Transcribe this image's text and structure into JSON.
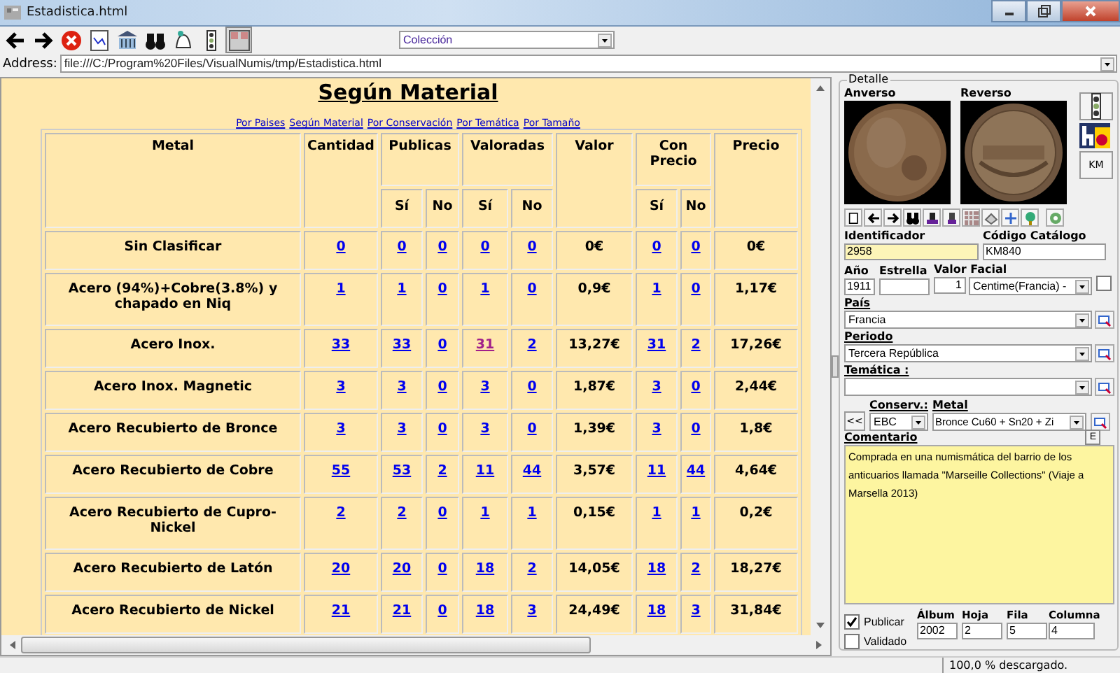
{
  "window": {
    "title": "Estadistica.html"
  },
  "toolbar": {
    "collection": "Colección"
  },
  "address": {
    "label": "Address:",
    "value": "file:///C:/Program%20Files/VisualNumis/tmp/Estadistica.html"
  },
  "page": {
    "heading": "Según Material",
    "nav_links": [
      {
        "label": "Por Paises"
      },
      {
        "label": "Según Material"
      },
      {
        "label": "Por Conservación"
      },
      {
        "label": "Por Temática"
      },
      {
        "label": "Por Tamaño"
      }
    ],
    "table": {
      "headers": {
        "metal": "Metal",
        "cantidad": "Cantidad",
        "publicas": "Publicas",
        "valoradas": "Valoradas",
        "valor": "Valor",
        "con_precio": "Con Precio",
        "precio": "Precio",
        "publicas_si": "Sí",
        "publicas_no": "No",
        "valoradas_si": "Sí",
        "valoradas_no": "No",
        "con_precio_si": "Sí",
        "con_precio_no": "No"
      },
      "rows": [
        {
          "metal": "Sin Clasificar",
          "cantidad": "0",
          "publicas_si": "0",
          "publicas_no": "0",
          "valoradas_si": "0",
          "valoradas_no": "0",
          "valor": "0€",
          "con_precio_si": "0",
          "con_precio_no": "0",
          "precio": "0€"
        },
        {
          "metal": "Acero (94%)+Cobre(3.8%) y chapado en Niq",
          "cantidad": "1",
          "publicas_si": "1",
          "publicas_no": "0",
          "valoradas_si": "1",
          "valoradas_no": "0",
          "valor": "0,9€",
          "con_precio_si": "1",
          "con_precio_no": "0",
          "precio": "1,17€"
        },
        {
          "metal": "Acero Inox.",
          "cantidad": "33",
          "publicas_si": "33",
          "publicas_no": "0",
          "valoradas_si": "31",
          "valoradas_no": "2",
          "valor": "13,27€",
          "con_precio_si": "31",
          "con_precio_no": "2",
          "precio": "17,26€",
          "valoradas_si_visited": true
        },
        {
          "metal": "Acero Inox. Magnetic",
          "cantidad": "3",
          "publicas_si": "3",
          "publicas_no": "0",
          "valoradas_si": "3",
          "valoradas_no": "0",
          "valor": "1,87€",
          "con_precio_si": "3",
          "con_precio_no": "0",
          "precio": "2,44€"
        },
        {
          "metal": "Acero Recubierto de Bronce",
          "cantidad": "3",
          "publicas_si": "3",
          "publicas_no": "0",
          "valoradas_si": "3",
          "valoradas_no": "0",
          "valor": "1,39€",
          "con_precio_si": "3",
          "con_precio_no": "0",
          "precio": "1,8€"
        },
        {
          "metal": "Acero Recubierto de Cobre",
          "cantidad": "55",
          "publicas_si": "53",
          "publicas_no": "2",
          "valoradas_si": "11",
          "valoradas_no": "44",
          "valor": "3,57€",
          "con_precio_si": "11",
          "con_precio_no": "44",
          "precio": "4,64€"
        },
        {
          "metal": "Acero Recubierto de Cupro-Nickel",
          "cantidad": "2",
          "publicas_si": "2",
          "publicas_no": "0",
          "valoradas_si": "1",
          "valoradas_no": "1",
          "valor": "0,15€",
          "con_precio_si": "1",
          "con_precio_no": "1",
          "precio": "0,2€"
        },
        {
          "metal": "Acero Recubierto de Latón",
          "cantidad": "20",
          "publicas_si": "20",
          "publicas_no": "0",
          "valoradas_si": "18",
          "valoradas_no": "2",
          "valor": "14,05€",
          "con_precio_si": "18",
          "con_precio_no": "2",
          "precio": "18,27€"
        },
        {
          "metal": "Acero Recubierto de Nickel",
          "cantidad": "21",
          "publicas_si": "21",
          "publicas_no": "0",
          "valoradas_si": "18",
          "valoradas_no": "3",
          "valor": "24,49€",
          "con_precio_si": "18",
          "con_precio_no": "3",
          "precio": "31,84€"
        }
      ]
    }
  },
  "detail": {
    "legend": "Detalle",
    "anverso": "Anverso",
    "reverso": "Reverso",
    "km_button": "KM",
    "identificador": {
      "label": "Identificador",
      "value": "2958"
    },
    "codigo": {
      "label": "Código Catálogo",
      "value": "KM840"
    },
    "anio": {
      "label": "Año",
      "value": "1911"
    },
    "estrella": {
      "label": "Estrella"
    },
    "valor_facial": {
      "label": "Valor Facial",
      "value": "1",
      "unit": "Centime(Francia) -",
      "checked": false
    },
    "pais": {
      "label": "País",
      "value": "Francia"
    },
    "periodo": {
      "label": "Periodo",
      "value": "Tercera República"
    },
    "tematica": {
      "label": "Temática :"
    },
    "back_button": "<<",
    "conserv": {
      "label": "Conserv.:",
      "value": "EBC"
    },
    "metal": {
      "label": "Metal",
      "value": "Bronce   Cu60 + Sn20 + Zi"
    },
    "e_button": "E",
    "comentario": {
      "label": "Comentario",
      "value": "Comprada en una numismática del barrio de los anticuarios llamada \"Marseille Collections\" (Viaje a Marsella 2013)"
    },
    "publicar": {
      "label": "Publicar",
      "checked": true
    },
    "validado": {
      "label": "Validado",
      "checked": false
    },
    "album": {
      "label": "Álbum",
      "value": "2002"
    },
    "hoja": {
      "label": "Hoja",
      "value": "2"
    },
    "fila": {
      "label": "Fila",
      "value": "5"
    },
    "columna": {
      "label": "Columna",
      "value": "4"
    }
  },
  "status_bar": {
    "text": "100,0 % descargado."
  }
}
